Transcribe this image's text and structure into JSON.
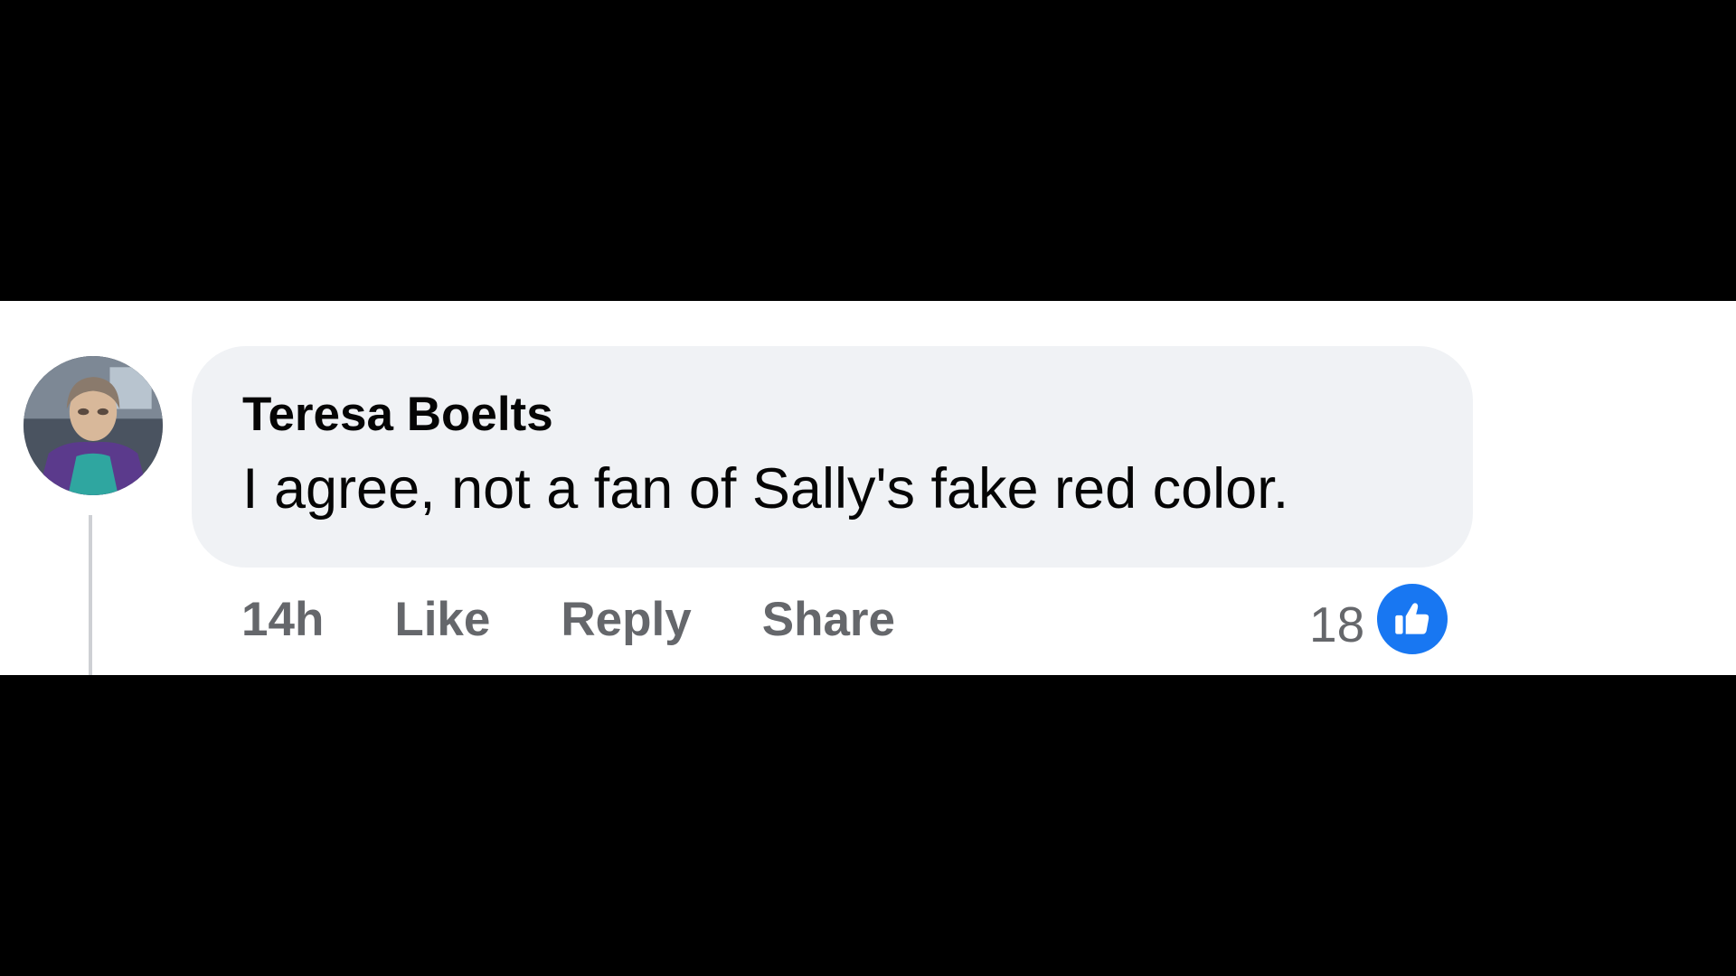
{
  "comment": {
    "author": "Teresa Boelts",
    "text": "I agree, not a fan of Sally's fake red color.",
    "timestamp": "14h",
    "actions": {
      "like_label": "Like",
      "reply_label": "Reply",
      "share_label": "Share"
    },
    "reactions": {
      "count": "18",
      "icon": "thumbs-up-icon",
      "color": "#1877f2"
    }
  },
  "colors": {
    "bubble_background": "#f0f2f5",
    "secondary_text": "#65676b",
    "primary_text": "#050505",
    "letterbox": "#000000"
  }
}
